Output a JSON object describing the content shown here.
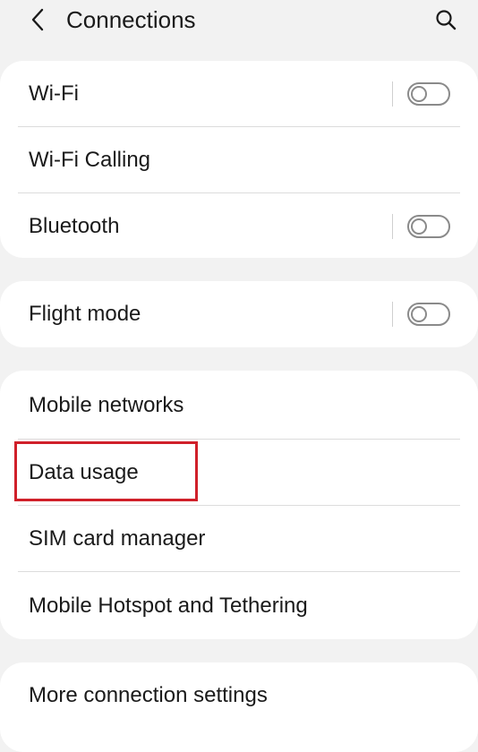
{
  "header": {
    "title": "Connections",
    "back_icon": "chevron-left-icon",
    "search_icon": "search-icon"
  },
  "groups": [
    {
      "items": [
        {
          "label": "Wi-Fi",
          "has_toggle": true,
          "toggle_on": false
        },
        {
          "label": "Wi-Fi Calling",
          "has_toggle": false
        },
        {
          "label": "Bluetooth",
          "has_toggle": true,
          "toggle_on": false
        }
      ]
    },
    {
      "items": [
        {
          "label": "Flight mode",
          "has_toggle": true,
          "toggle_on": false
        }
      ]
    },
    {
      "items": [
        {
          "label": "Mobile networks",
          "has_toggle": false
        },
        {
          "label": "Data usage",
          "has_toggle": false,
          "highlighted": true
        },
        {
          "label": "SIM card manager",
          "has_toggle": false
        },
        {
          "label": "Mobile Hotspot and Tethering",
          "has_toggle": false
        }
      ]
    },
    {
      "items": [
        {
          "label": "More connection settings",
          "has_toggle": false
        }
      ]
    }
  ],
  "colors": {
    "background": "#f2f2f2",
    "card": "#ffffff",
    "highlight_border": "#d0202a",
    "toggle_border": "#8a8a8a"
  }
}
